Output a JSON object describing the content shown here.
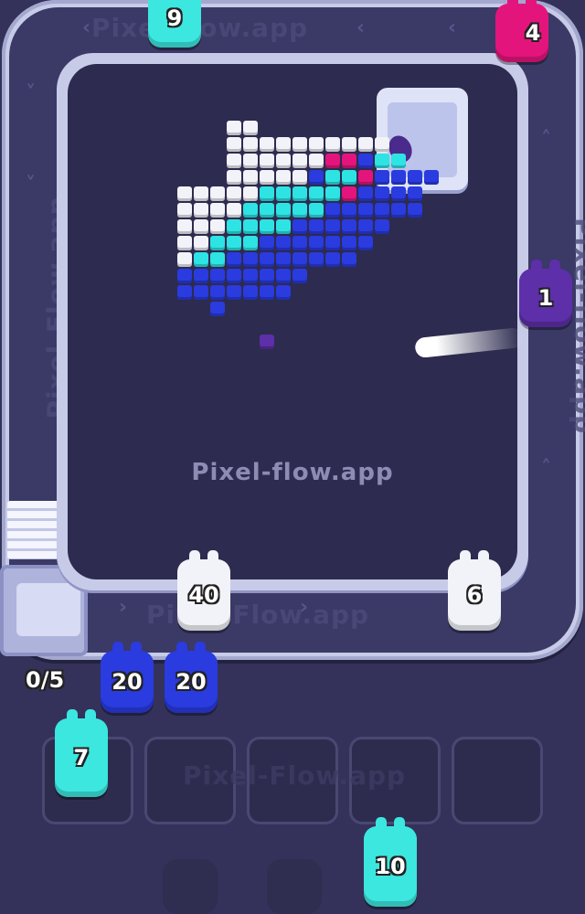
{
  "watermark": "Pixel-flow.app",
  "track_text": {
    "top": "Pixel-flow.app",
    "bottom": "Pixel-Flow.app",
    "left": "Pixel-Flow.app",
    "right": "Pixel-flow.app",
    "slots": "Pixel-Flow.app"
  },
  "counter": "0/5",
  "colors": {
    "white": "#f2f3f8",
    "cyan": "#2ee3e3",
    "light_cyan": "#5ff2f2",
    "blue": "#2a3be0",
    "dark_blue": "#1f2fc8",
    "magenta": "#e3157c",
    "purple": "#5d2fa8",
    "background": "#34325a"
  },
  "conveyor_shooters": [
    {
      "number": "9",
      "color": "cyan",
      "name": "shooter-cyan-9"
    },
    {
      "number": "4",
      "color": "magenta",
      "name": "shooter-magenta-4"
    },
    {
      "number": "1",
      "color": "purple",
      "name": "shooter-purple-1"
    },
    {
      "number": "6",
      "color": "white",
      "name": "shooter-white-6"
    },
    {
      "number": "40",
      "color": "white",
      "name": "shooter-white-40"
    }
  ],
  "queue": [
    {
      "number": "20",
      "color": "blue"
    },
    {
      "number": "20",
      "color": "blue"
    },
    {
      "number": "7",
      "color": "cyan"
    },
    {
      "number": "10",
      "color": "cyan"
    }
  ],
  "pixel_art": {
    "rows": [
      "...WW.................",
      "...WWWWWWWWWW.........",
      "...WWWWWWMMBCC........",
      "...WWWWWBCCMBBBB......",
      "WWWWWCCCCCMBBBB.......",
      "WWWWCCCCCBBBBBB.......",
      "WWWCCCCBBBBBB.........",
      "WWCCCBBBBBBB..........",
      "WCCBBBBBBBB...........",
      "BBBBBBBB..............",
      "BBBBBBB...............",
      "..B...................",
      "......................",
      ".....P................"
    ],
    "legend": {
      "W": "white",
      "C": "cyan",
      "B": "blue",
      "M": "magenta",
      "P": "purple"
    }
  }
}
